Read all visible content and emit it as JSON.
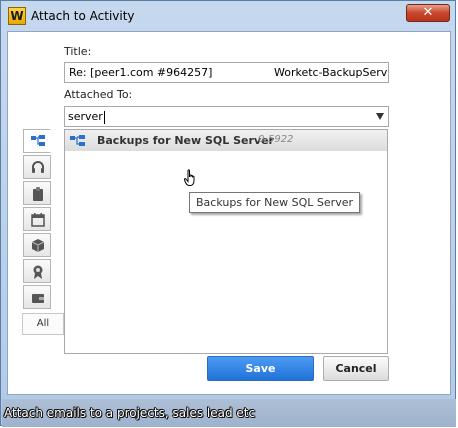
{
  "window": {
    "title": "Attach to Activity",
    "app_logo": "W",
    "close_glyph": "✕"
  },
  "form": {
    "title_label": "Title:",
    "title_value_left": "Re: [peer1.com #964257]",
    "title_value_right": "Worketc-BackupServ",
    "attached_to_label": "Attached To:",
    "attached_to_value": "server"
  },
  "tabs": [
    {
      "icon": "project-icon",
      "active": true
    },
    {
      "icon": "headset-icon",
      "active": false
    },
    {
      "icon": "clipboard-icon",
      "active": false
    },
    {
      "icon": "calendar-icon",
      "active": false
    },
    {
      "icon": "box-icon",
      "active": false
    },
    {
      "icon": "award-icon",
      "active": false
    },
    {
      "icon": "wallet-icon",
      "active": false
    }
  ],
  "all_tab_label": "All",
  "results": [
    {
      "title": "Backups for New SQL Server",
      "code": "0-5922",
      "icon": "project-icon"
    }
  ],
  "tooltip": "Backups for New SQL Server",
  "buttons": {
    "save": "Save",
    "cancel": "Cancel"
  },
  "caption": "Attach emails to a projects, sales lead etc",
  "colors": {
    "accent": "#2e7de0",
    "project_icon": "#2a6fc9"
  }
}
